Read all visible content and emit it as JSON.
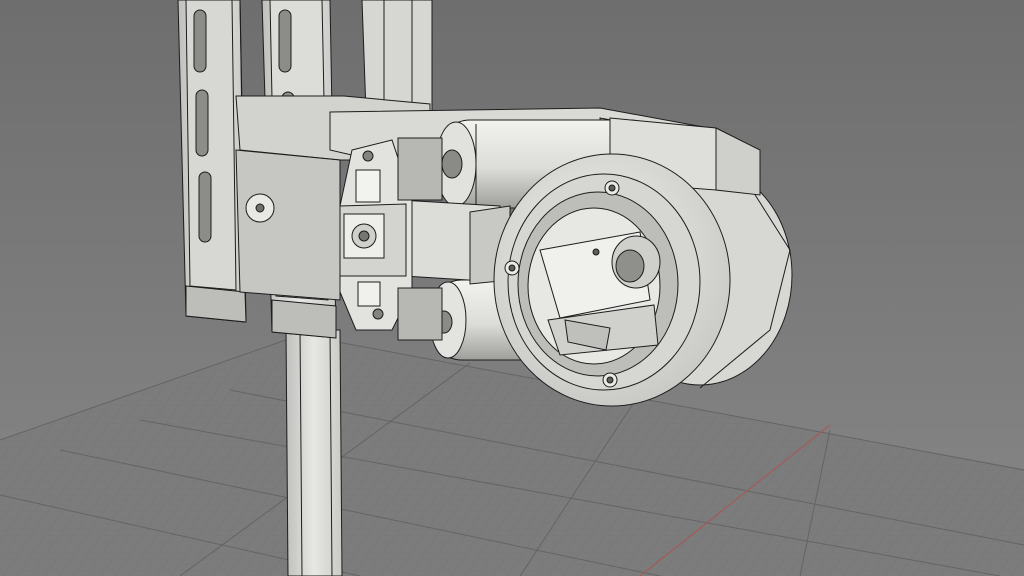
{
  "scene": {
    "kind": "cad-3d-viewport",
    "model": "gimbal-mount-assembly",
    "colors": {
      "background_top": "#6f6f6f",
      "background_bottom": "#858585",
      "ground_grid": "#7c7c7c",
      "grid_line": "#6a6a6a",
      "grid_major": "#5e5e5e",
      "x_axis": "#a05555",
      "part_light": "#e9e9e6",
      "part_mid": "#cfcfcc",
      "part_shadow": "#9d9d9a",
      "edge": "#1d1d1d"
    }
  }
}
